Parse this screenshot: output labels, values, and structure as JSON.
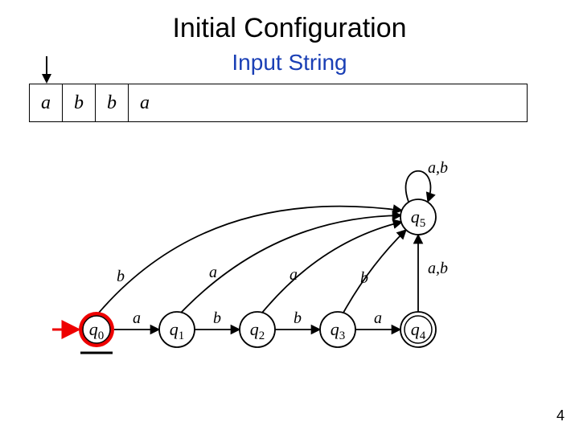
{
  "title": "Initial Configuration",
  "subtitle": "Input String",
  "tape": [
    "a",
    "b",
    "b",
    "a"
  ],
  "page_number": "4",
  "automaton": {
    "states": {
      "q0": {
        "label": "q",
        "sub": "0",
        "accepting": false,
        "initial": true,
        "highlighted": true
      },
      "q1": {
        "label": "q",
        "sub": "1",
        "accepting": false,
        "initial": false,
        "highlighted": false
      },
      "q2": {
        "label": "q",
        "sub": "2",
        "accepting": false,
        "initial": false,
        "highlighted": false
      },
      "q3": {
        "label": "q",
        "sub": "3",
        "accepting": false,
        "initial": false,
        "highlighted": false
      },
      "q4": {
        "label": "q",
        "sub": "4",
        "accepting": true,
        "initial": false,
        "highlighted": false
      },
      "q5": {
        "label": "q",
        "sub": "5",
        "accepting": false,
        "initial": false,
        "highlighted": false
      }
    },
    "transitions": [
      {
        "from": "q0",
        "to": "q1",
        "label": "a"
      },
      {
        "from": "q1",
        "to": "q2",
        "label": "b"
      },
      {
        "from": "q2",
        "to": "q3",
        "label": "b"
      },
      {
        "from": "q3",
        "to": "q4",
        "label": "a"
      },
      {
        "from": "q0",
        "to": "q5",
        "label": "b"
      },
      {
        "from": "q1",
        "to": "q5",
        "label": "a"
      },
      {
        "from": "q2",
        "to": "q5",
        "label": "a"
      },
      {
        "from": "q3",
        "to": "q5",
        "label": "b"
      },
      {
        "from": "q4",
        "to": "q5",
        "label": "a,b"
      },
      {
        "from": "q5",
        "to": "q5",
        "label": "a,b"
      }
    ]
  }
}
